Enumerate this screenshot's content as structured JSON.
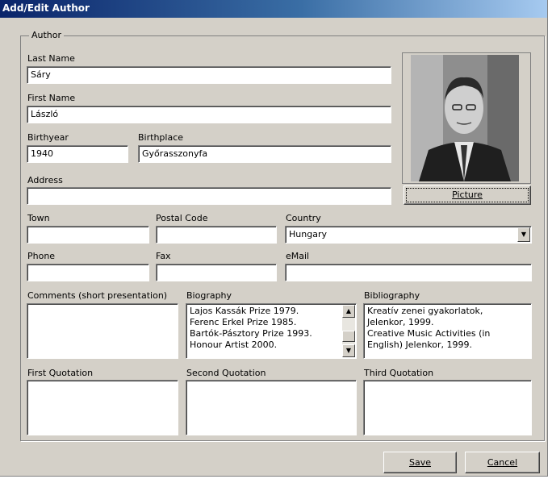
{
  "window": {
    "title": "Add/Edit Author"
  },
  "group": {
    "legend": "Author"
  },
  "fields": {
    "last_name": {
      "label": "Last Name",
      "value": "Sáry"
    },
    "first_name": {
      "label": "First Name",
      "value": "László"
    },
    "birthyear": {
      "label": "Birthyear",
      "value": "1940"
    },
    "birthplace": {
      "label": "Birthplace",
      "value": "Győrasszonyfa"
    },
    "address": {
      "label": "Address",
      "value": ""
    },
    "town": {
      "label": "Town",
      "value": ""
    },
    "postal_code": {
      "label": "Postal Code",
      "value": ""
    },
    "country": {
      "label": "Country",
      "value": "Hungary"
    },
    "phone": {
      "label": "Phone",
      "value": ""
    },
    "fax": {
      "label": "Fax",
      "value": ""
    },
    "email": {
      "label": "eMail",
      "value": ""
    },
    "comments": {
      "label": "Comments (short presentation)",
      "value": ""
    },
    "biography": {
      "label": "Biography",
      "lines": [
        "Lajos Kassák Prize 1979.",
        "Ferenc Erkel Prize 1985.",
        "Bartók-Pásztory Prize 1993.",
        "Honour Artist 2000."
      ]
    },
    "bibliography": {
      "label": "Bibliography",
      "lines": [
        "Kreatív zenei gyakorlatok,",
        "Jelenkor, 1999.",
        "Creative Music Activities (in",
        "English) Jelenkor, 1999."
      ]
    },
    "first_quotation": {
      "label": "First Quotation",
      "value": ""
    },
    "second_quotation": {
      "label": "Second Quotation",
      "value": ""
    },
    "third_quotation": {
      "label": "Third Quotation",
      "value": ""
    }
  },
  "buttons": {
    "picture": "Picture",
    "save": "Save",
    "cancel": "Cancel"
  },
  "icons": {
    "dropdown": "chevron-down-icon",
    "scroll_up": "arrow-up-icon",
    "scroll_down": "arrow-down-icon"
  },
  "colors": {
    "title_start": "#0a246a",
    "title_end": "#a6caf0",
    "face": "#d4d0c8"
  }
}
